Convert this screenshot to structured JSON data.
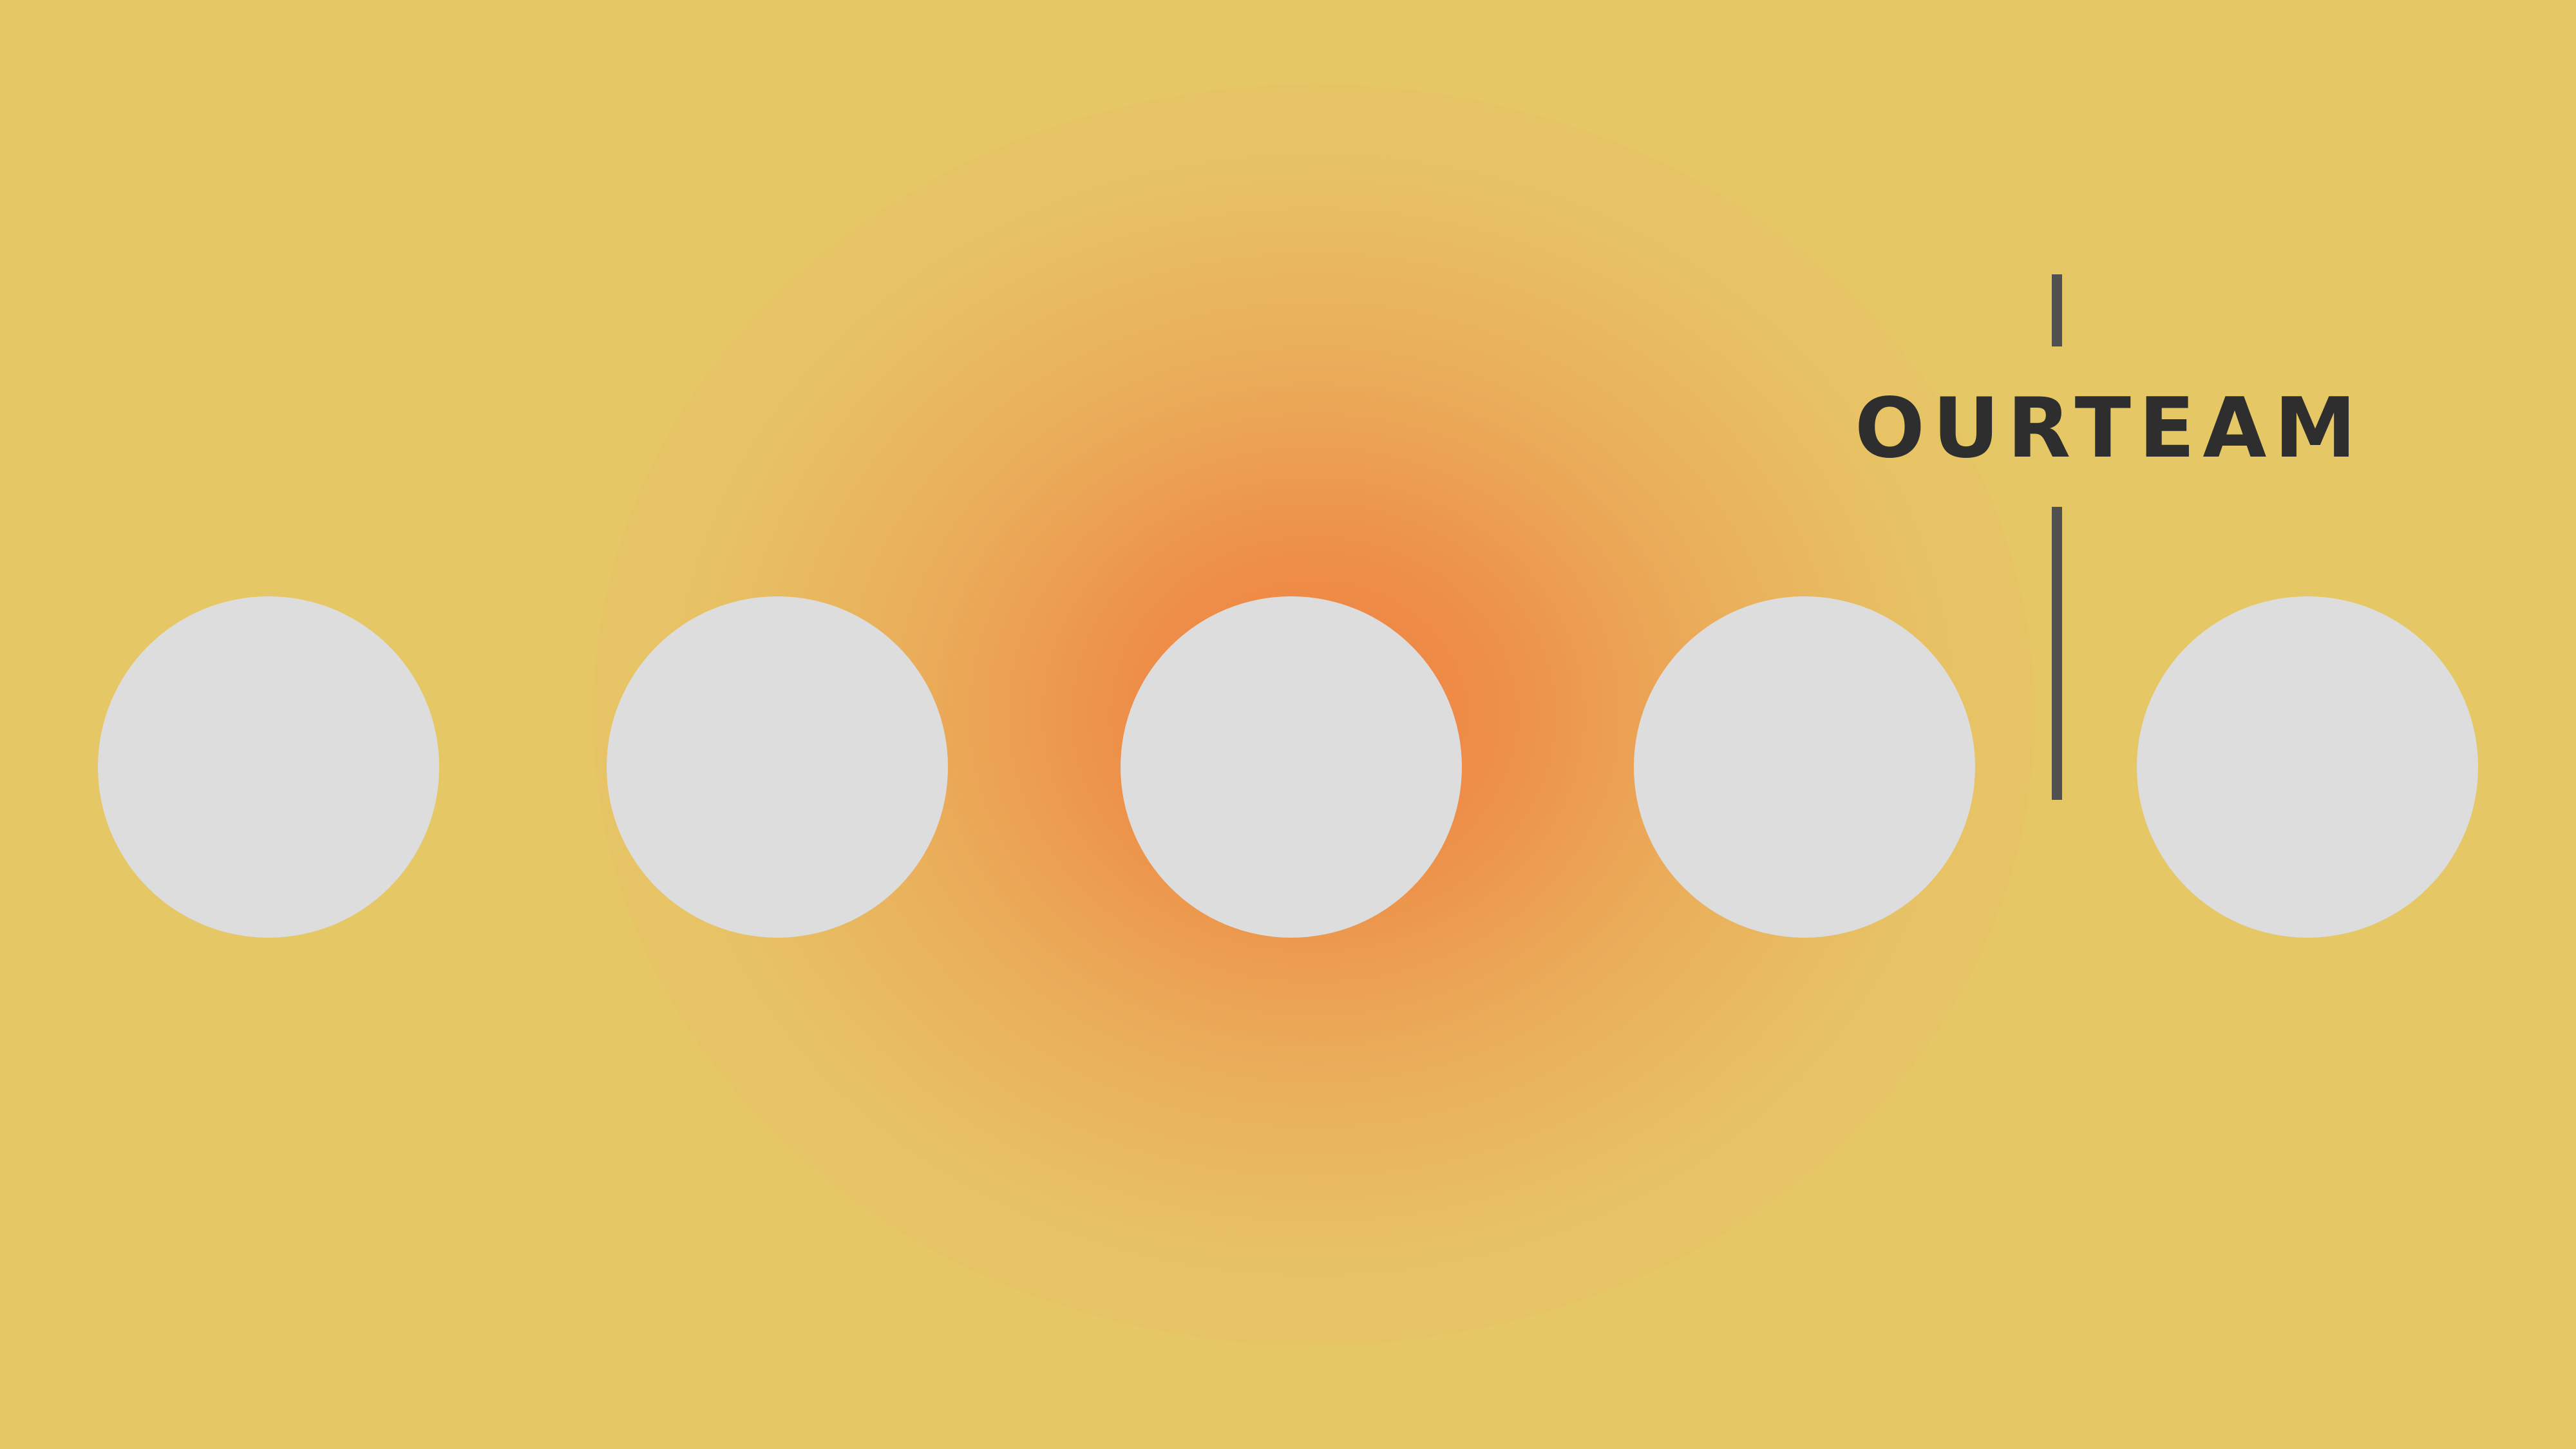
{
  "title": "OURTEAM",
  "team_photos": [
    {
      "shape": "circle",
      "state": "placeholder"
    },
    {
      "shape": "circle",
      "state": "placeholder"
    },
    {
      "shape": "circle",
      "state": "placeholder"
    },
    {
      "shape": "circle",
      "state": "placeholder"
    },
    {
      "shape": "circle",
      "state": "placeholder"
    }
  ],
  "colors": {
    "background": "#e6c766",
    "glow": "#ee8042",
    "photo_placeholder": "#dddddd",
    "accent_rule": "#505050",
    "title_text": "#2e2e2e"
  }
}
